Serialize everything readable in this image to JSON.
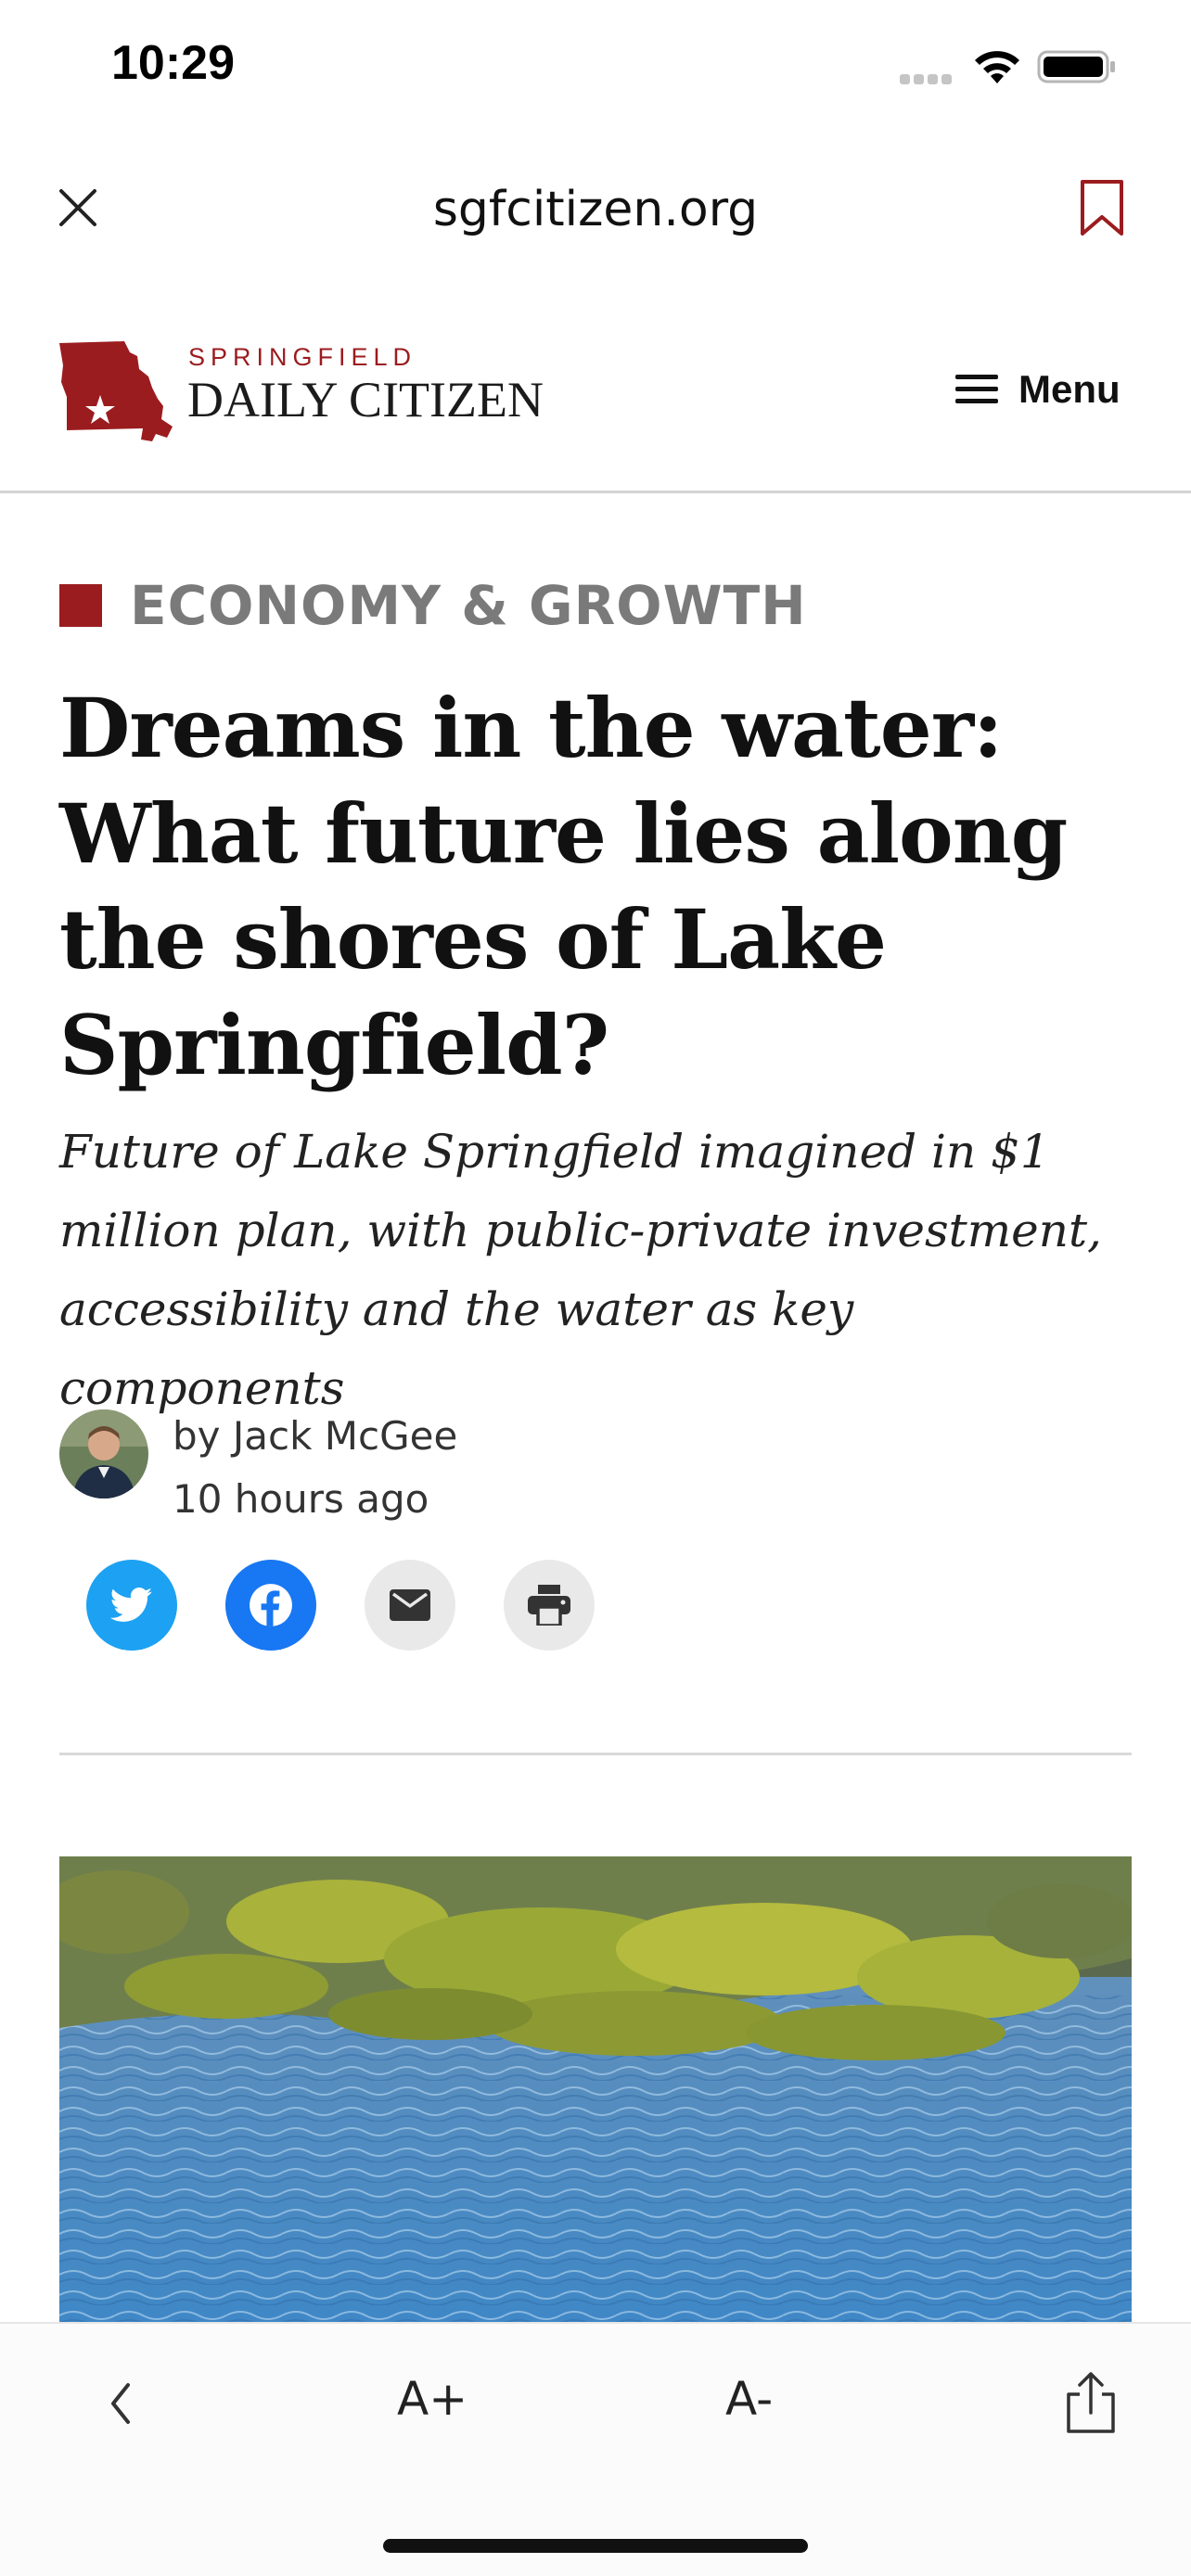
{
  "status_bar": {
    "time": "10:29",
    "icons": [
      "signal-icon",
      "wifi-icon",
      "battery-icon"
    ]
  },
  "browser": {
    "domain": "sgfcitizen.org",
    "close_icon": "close-icon",
    "bookmark_icon": "bookmark-icon"
  },
  "site": {
    "logo_small": "SPRINGFIELD",
    "logo_big": "DAILY CITIZEN",
    "menu_label": "Menu",
    "brand_color": "#9b1c1f"
  },
  "article": {
    "category": "ECONOMY & GROWTH",
    "headline": "Dreams in the water: What future lies along the shores of Lake Springfield?",
    "dek": "Future of Lake Springfield imagined in $1 million plan, with public-private investment, accessibility and the water as key components",
    "byline": "by Jack McGee",
    "timestamp": "10 hours ago"
  },
  "share": {
    "twitter_color": "#1da1f2",
    "facebook_color": "#1877f2",
    "buttons": [
      "twitter-icon",
      "facebook-icon",
      "email-icon",
      "print-icon"
    ]
  },
  "toolbar": {
    "back_icon": "chevron-left-icon",
    "font_increase": "A+",
    "font_decrease": "A-",
    "share_icon": "share-icon"
  }
}
